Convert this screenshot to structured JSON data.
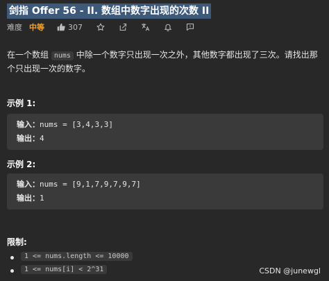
{
  "problem": {
    "title": "剑指 Offer 56 - II. 数组中数字出现的次数 II",
    "difficulty_label": "难度",
    "difficulty": "中等",
    "likes": "307",
    "difficulty_color": "#ffa116"
  },
  "toolbar_icons": [
    "thumbs-up-icon",
    "star-icon",
    "share-icon",
    "translate-icon",
    "bell-icon",
    "feedback-icon"
  ],
  "description": {
    "before": "在一个数组 ",
    "code": "nums",
    "after": " 中除一个数字只出现一次之外，其他数字都出现了三次。请找出那个只出现一次的数字。"
  },
  "examples": [
    {
      "title": "示例 1:",
      "input_label": "输入：",
      "input": "nums = [3,4,3,3]",
      "output_label": "输出：",
      "output": "4"
    },
    {
      "title": "示例 2:",
      "input_label": "输入：",
      "input": "nums = [9,1,7,9,7,9,7]",
      "output_label": "输出：",
      "output": "1"
    }
  ],
  "constraints": {
    "title": "限制:",
    "items": [
      "1 <= nums.length <= 10000",
      "1 <= nums[i] < 2^31"
    ]
  },
  "watermark": "CSDN @junewgl"
}
